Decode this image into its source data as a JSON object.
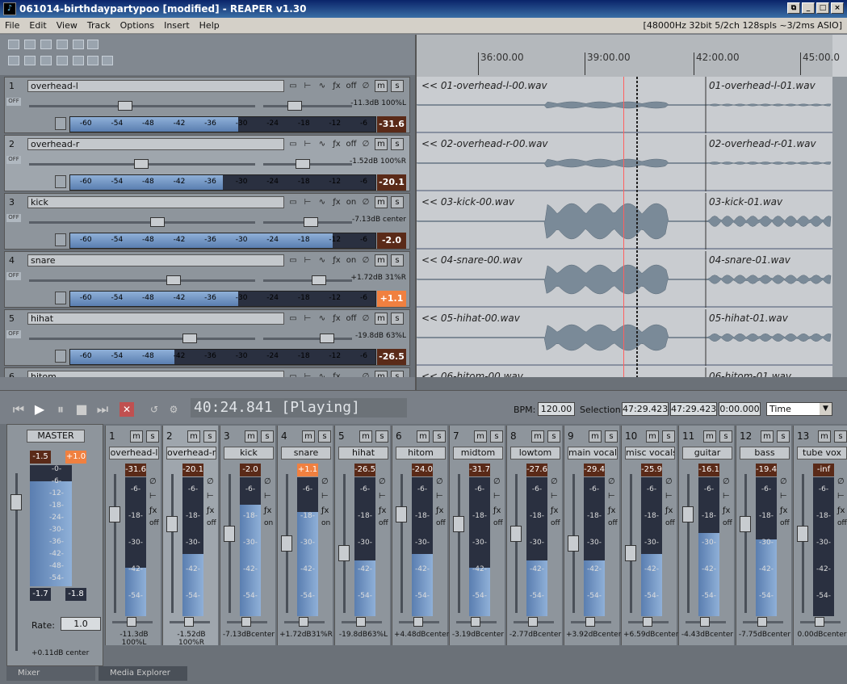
{
  "window": {
    "title": "061014-birthdaypartypoo [modified] - REAPER v1.30",
    "buttons": [
      "restore",
      "minimize",
      "maximize",
      "close"
    ]
  },
  "menu": {
    "items": [
      "File",
      "Edit",
      "View",
      "Track",
      "Options",
      "Insert",
      "Help"
    ],
    "status": "[48000Hz 32bit 5/2ch 128spls ~3/2ms ASIO]"
  },
  "ruler": {
    "labels": [
      "36:00.00",
      "39:00.00",
      "42:00.00",
      "45:00.0"
    ]
  },
  "tracks": [
    {
      "num": "1",
      "name": "overhead-l",
      "fx": "off",
      "vol": "-11.3dB 100%L",
      "peak": "-31.6",
      "meter": 0.55,
      "hot": false,
      "item_a": "<< 01-overhead-l-00.wav",
      "item_b": "01-overhead-l-01.wav"
    },
    {
      "num": "2",
      "name": "overhead-r",
      "fx": "off",
      "vol": "-1.52dB 100%R",
      "peak": "-20.1",
      "meter": 0.5,
      "hot": false,
      "item_a": "<< 02-overhead-r-00.wav",
      "item_b": "02-overhead-r-01.wav"
    },
    {
      "num": "3",
      "name": "kick",
      "fx": "on",
      "vol": "-7.13dB center",
      "peak": "-2.0",
      "meter": 0.86,
      "hot": false,
      "item_a": "<< 03-kick-00.wav",
      "item_b": "03-kick-01.wav"
    },
    {
      "num": "4",
      "name": "snare",
      "fx": "on",
      "vol": "+1.72dB 31%R",
      "peak": "+1.1",
      "meter": 0.55,
      "hot": true,
      "item_a": "<< 04-snare-00.wav",
      "item_b": "04-snare-01.wav"
    },
    {
      "num": "5",
      "name": "hihat",
      "fx": "off",
      "vol": "-19.8dB 63%L",
      "peak": "-26.5",
      "meter": 0.34,
      "hot": false,
      "item_a": "<< 05-hihat-00.wav",
      "item_b": "05-hihat-01.wav"
    },
    {
      "num": "6",
      "name": "hitom",
      "fx": "",
      "vol": "",
      "peak": "",
      "meter": 0,
      "hot": false,
      "item_a": "<< 06-hitom-00.wav",
      "item_b": "06-hitom-01.wav"
    }
  ],
  "meter_scale": [
    "-60",
    "-54",
    "-48",
    "-42",
    "-36",
    "-30",
    "-24",
    "-18",
    "-12",
    "-6"
  ],
  "transport": {
    "time": "40:24.841 [Playing]",
    "bpm_label": "BPM:",
    "bpm": "120.00",
    "selection_label": "Selection:",
    "sel_start": "47:29.423",
    "sel_end": "47:29.423",
    "sel_len": "0:00.000",
    "time_mode": "Time"
  },
  "master": {
    "label": "MASTER",
    "peak_l": "-1.5",
    "peak_r": "+1.0",
    "bottom_l": "-1.7",
    "bottom_r": "-1.8",
    "rate_label": "Rate:",
    "rate": "1.0",
    "vol": "+0.11dB center",
    "scale": [
      "-0-",
      "-6-",
      "-12-",
      "-18-",
      "-24-",
      "-30-",
      "-36-",
      "-42-",
      "-48-",
      "-54-"
    ]
  },
  "mixer_channels": [
    {
      "num": "1",
      "name": "overhead-l",
      "peak": "-31.6",
      "level": 0.35,
      "fx": "off",
      "vol": "-11.3dB 100%L",
      "hot": false
    },
    {
      "num": "2",
      "name": "overhead-r",
      "peak": "-20.1",
      "level": 0.45,
      "fx": "off",
      "vol": "-1.52dB 100%R",
      "hot": false
    },
    {
      "num": "3",
      "name": "kick",
      "peak": "-2.0",
      "level": 0.8,
      "fx": "on",
      "vol": "-7.13dBcenter",
      "hot": false
    },
    {
      "num": "4",
      "name": "snare",
      "peak": "+1.1",
      "level": 0.75,
      "fx": "on",
      "vol": "+1.72dB31%R",
      "hot": true
    },
    {
      "num": "5",
      "name": "hihat",
      "peak": "-26.5",
      "level": 0.4,
      "fx": "off",
      "vol": "-19.8dB63%L",
      "hot": false
    },
    {
      "num": "6",
      "name": "hitom",
      "peak": "-24.0",
      "level": 0.45,
      "fx": "off",
      "vol": "+4.48dBcenter",
      "hot": false
    },
    {
      "num": "7",
      "name": "midtom",
      "peak": "-31.7",
      "level": 0.35,
      "fx": "off",
      "vol": "-3.19dBcenter",
      "hot": false
    },
    {
      "num": "8",
      "name": "lowtom",
      "peak": "-27.6",
      "level": 0.4,
      "fx": "off",
      "vol": "-2.77dBcenter",
      "hot": false
    },
    {
      "num": "9",
      "name": "main vocals",
      "peak": "-29.4",
      "level": 0.4,
      "fx": "off",
      "vol": "+3.92dBcenter",
      "hot": false
    },
    {
      "num": "10",
      "name": "misc vocals",
      "peak": "-25.9",
      "level": 0.45,
      "fx": "off",
      "vol": "+6.59dBcenter",
      "hot": false
    },
    {
      "num": "11",
      "name": "guitar",
      "peak": "-16.1",
      "level": 0.6,
      "fx": "off",
      "vol": "-4.43dBcenter",
      "hot": false
    },
    {
      "num": "12",
      "name": "bass",
      "peak": "-19.4",
      "level": 0.55,
      "fx": "off",
      "vol": "-7.75dBcenter",
      "hot": false
    },
    {
      "num": "13",
      "name": "tube vox",
      "peak": "-inf",
      "level": 0,
      "fx": "off",
      "vol": "0.00dBcenter",
      "hot": false
    }
  ],
  "mixer_scale": [
    "-6-",
    "-18-",
    "-30-",
    "-42-",
    "-54-"
  ],
  "tabs": [
    "Mixer",
    "Media Explorer"
  ]
}
